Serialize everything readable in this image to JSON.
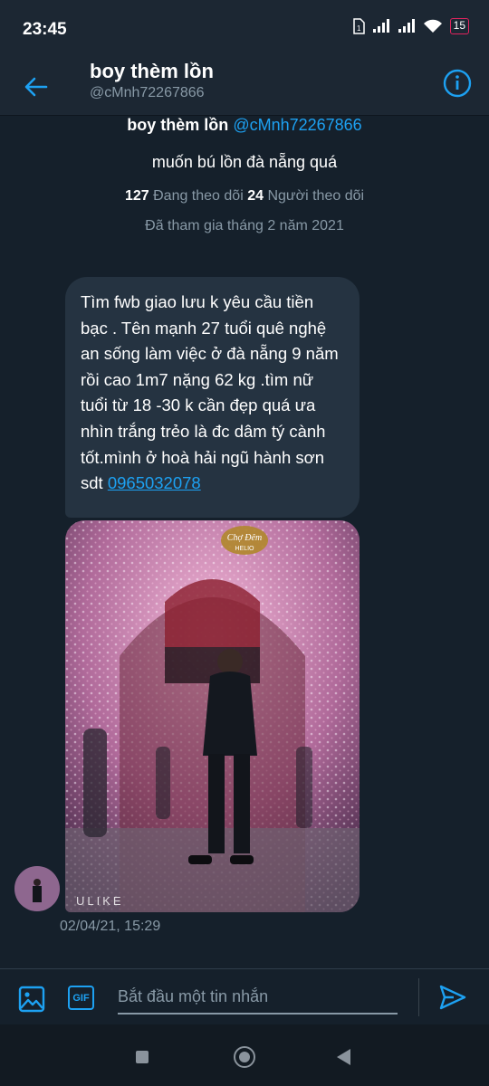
{
  "status_bar": {
    "time": "23:45",
    "battery": "15"
  },
  "header": {
    "name": "boy thèm lồn",
    "handle": "@cMnh72267866"
  },
  "profile": {
    "name": "boy thèm lồn",
    "handle": "@cMnh72267866",
    "bio": "muốn bú lồn đà nẵng quá",
    "following_count": "127",
    "following_label": "Đang theo dõi",
    "followers_count": "24",
    "followers_label": "Người theo dõi",
    "joined": "Đã tham gia tháng 2 năm 2021"
  },
  "message": {
    "text": "Tìm fwb giao lưu k yêu cầu tiền bạc . Tên mạnh 27 tuổi quê nghệ an sống làm việc ở đà nẵng 9 năm rồi cao 1m7 nặng 62 kg .tìm nữ tuổi từ 18 -30 k cần đẹp quá ưa nhìn trắng trẻo là đc dâm tý cành tốt.mình ở hoà hải ngũ hành sơn sdt",
    "phone": "0965032078",
    "photo_sign": "Chợ Đêm",
    "photo_sign_sub": "HELIO",
    "photo_watermark": "ULIKE",
    "timestamp": "02/04/21, 15:29"
  },
  "composer": {
    "placeholder": "Bắt đầu một tin nhắn",
    "gif_label": "GIF"
  },
  "colors": {
    "background": "#15202b",
    "accent": "#1da1f2",
    "bubble": "#253341",
    "muted": "#8899a6"
  },
  "icons": [
    "back-arrow-icon",
    "info-icon",
    "image-icon",
    "gif-icon",
    "send-icon",
    "wifi-icon",
    "signal-icon",
    "sim-icon",
    "battery-icon"
  ]
}
